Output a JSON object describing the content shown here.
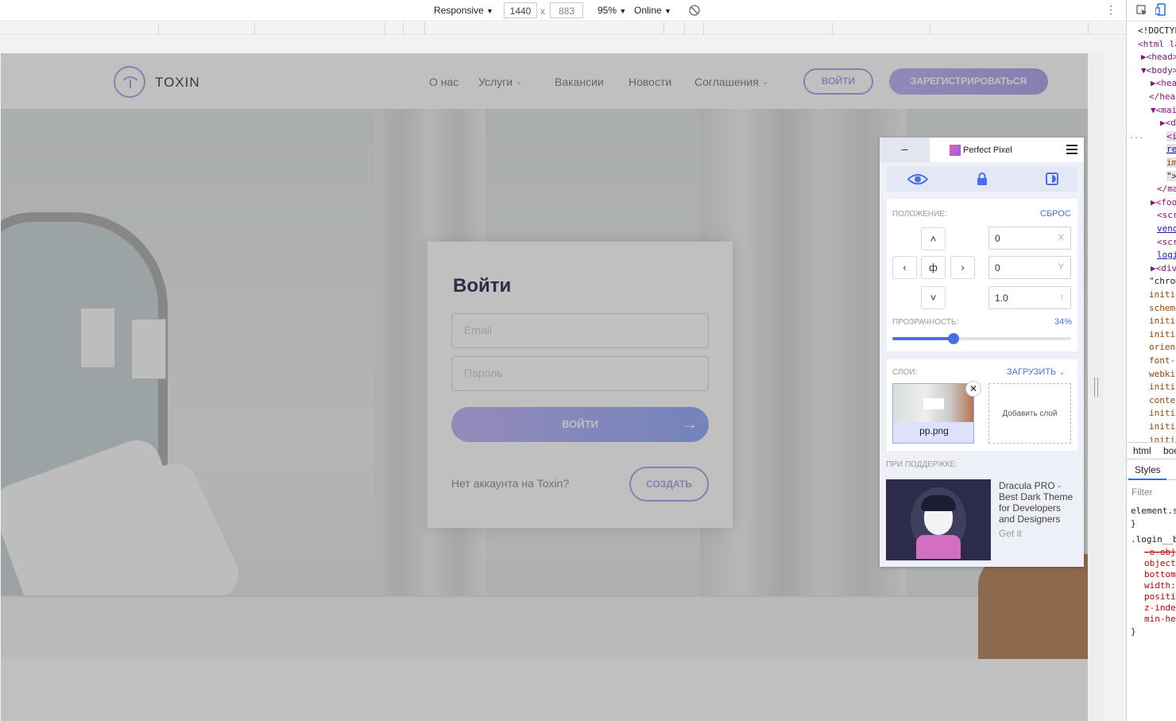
{
  "devtools_toolbar": {
    "device": "Responsive",
    "device_arrow": "▼",
    "width": "1440",
    "times": "x",
    "height": "883",
    "zoom": "95%",
    "zoom_arrow": "▼",
    "throttle": "Online",
    "throttle_arrow": "▼"
  },
  "site": {
    "logo_text": "TOXIN",
    "nav": [
      {
        "label": "О нас"
      },
      {
        "label": "Услуги",
        "has_dropdown": true
      },
      {
        "label": "Вакансии"
      },
      {
        "label": "Новости"
      },
      {
        "label": "Соглашения",
        "has_dropdown": true
      }
    ],
    "login_button": "ВОЙТИ",
    "register_button": "ЗАРЕГИСТРИРОВАТЬСЯ",
    "accent_color": "#a79de6"
  },
  "login_card": {
    "title": "Войти",
    "email_placeholder": "Email",
    "password_placeholder": "Пароль",
    "submit_label": "ВОЙТИ",
    "submit_arrow": "→",
    "no_account_text": "Нет аккаунта на Toxin?",
    "create_label": "СОЗДАТЬ"
  },
  "perfect_pixel": {
    "minimize": "–",
    "title": "Perfect Pixel",
    "position_label": "ПОЛОЖЕНИЕ:",
    "reset_label": "СБРОС",
    "arrows": {
      "up": "˄",
      "left": "‹",
      "center": "ф",
      "right": "›",
      "down": "˅"
    },
    "x_value": "0",
    "x_suffix": "X",
    "y_value": "0",
    "y_suffix": "Y",
    "scale_value": "1.0",
    "scale_suffix": "↑",
    "opacity_label": "ПРОЗРАЧНОСТЬ:",
    "opacity_value": "34%",
    "opacity_fraction": 0.34,
    "layers_label": "СЛОИ:",
    "upload_label": "ЗАГРУЗИТЬ",
    "layer_name": "pp.png",
    "layer_close": "✕",
    "add_layer_label": "Добавить слой",
    "sponsor_label": "ПРИ ПОДДЕРЖКЕ:",
    "ad_text": "Dracula PRO - Best Dark Theme for Developers and Designers",
    "ad_cta": "Get it",
    "accent_color": "#4b6fe6"
  },
  "elements_panel": {
    "lines": [
      "<!DOCTYPE",
      "<html la",
      "▶<head>",
      "▼<body>",
      "▶<hea",
      "</head",
      "▼<mai",
      "▶<d",
      "<i",
      "re",
      "im",
      "\">",
      "</ma",
      "▶<foo",
      "<scr",
      "vend",
      "<scr",
      "logi",
      "▶<div",
      "\"chrom",
      "initia",
      "scheme",
      "initia",
      "initia",
      "orient",
      "font-s",
      "webkit",
      "initia",
      "conter",
      "initia",
      "initia",
      "initia"
    ],
    "ellipsis": "...",
    "breadcrumb": [
      "html",
      "boo"
    ],
    "styles_tab": "Styles",
    "filter_placeholder": "Filter",
    "rules": [
      "element.s",
      "}",
      ".login__b",
      "-o-obj",
      "object",
      "bottom",
      "width:",
      "positi",
      "z-inde",
      "min-he",
      "}"
    ]
  }
}
